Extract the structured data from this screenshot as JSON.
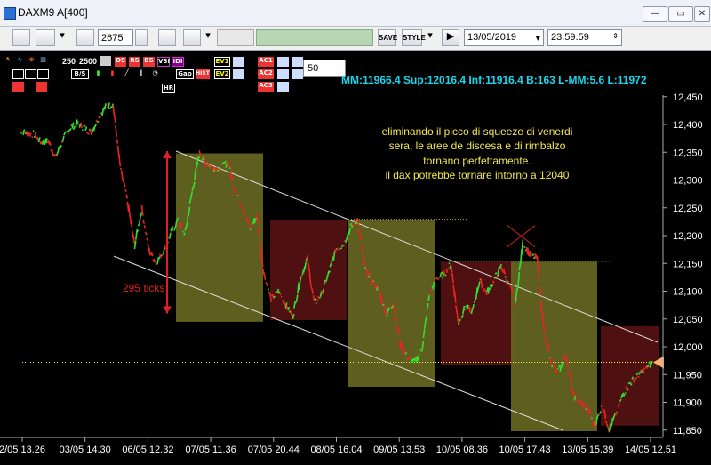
{
  "window": {
    "title": "DAXM9 A[400]"
  },
  "toolbar": {
    "count_value": "2675",
    "date_value": "13/05/2019",
    "time_value": "23.59.59",
    "save_label": "SAVE",
    "style_label": "STYLE"
  },
  "chart_toolbar": {
    "zoom_a": "250",
    "zoom_b": "2500",
    "period_value": "50",
    "buttons_row1": [
      "OS",
      "RS",
      "BS",
      "VSI",
      "IDI",
      "EV1",
      "AC1"
    ],
    "buttons_row2": [
      "B/S",
      "HR",
      "Gap",
      "HIST",
      "EV2",
      "AC2",
      "AC3"
    ]
  },
  "info": {
    "text": "MM:11966.4 Sup:12016.4 Inf:11916.4 B:163 L-MM:5.6 L:11972"
  },
  "annotation": {
    "lines": [
      "eliminando il picco di squeeze di venerdi",
      "sera, le aree de discesa e di rimbalzo",
      "tornano perfettamente.",
      "il dax potrebbe tornare intorno a 12040"
    ],
    "ticks_label": "295 ticks"
  },
  "colors": {
    "up": "#33dd33",
    "down": "#ee2222",
    "info": "#17d6ee",
    "olive_box": "#666622",
    "red_box": "#551111",
    "annotation": "#f0e850"
  },
  "chart_data": {
    "type": "line",
    "ylim": [
      11840,
      12440
    ],
    "y_ticks": [
      "12,450",
      "12,400",
      "12,350",
      "12,300",
      "12,250",
      "12,200",
      "12,150",
      "12,100",
      "12,050",
      "12,000",
      "11,950",
      "11,900",
      "11,850"
    ],
    "x_labels": [
      "2/05 13.26",
      "03/05 14.30",
      "06/05 12.32",
      "07/05 11.36",
      "07/05 20.44",
      "08/05 16.04",
      "09/05 13.53",
      "10/05 08.36",
      "10/05 17.43",
      "13/05 15.39",
      "14/05 12.51"
    ],
    "series": [
      {
        "values": [
          12390,
          12384,
          12382,
          12368,
          12370,
          12340,
          12372,
          12393,
          12402,
          12394,
          12386,
          12413,
          12432,
          12436,
          12322,
          12262,
          12182,
          12248,
          12173,
          12151,
          12172,
          12203,
          12226,
          12202,
          12279,
          12348,
          12330,
          12322,
          12321,
          12333,
          12279,
          12254,
          12211,
          12235,
          12130,
          12086,
          12100,
          12076,
          12055,
          12120,
          12158,
          12078,
          12095,
          12132,
          12176,
          12184,
          12213,
          12230,
          12142,
          12118,
          12101,
          12058,
          12080,
          12003,
          11980,
          11972,
          11998,
          12094,
          12123,
          12130,
          12150,
          12043,
          12072,
          12064,
          12120,
          12097,
          12120,
          12145,
          12113,
          12080,
          12187,
          12166,
          12158,
          12020,
          11968,
          11957,
          11985,
          11912,
          11900,
          11888,
          11857,
          11895,
          11852,
          11880,
          11917,
          11936,
          11948,
          11960,
          11972
        ]
      }
    ]
  }
}
